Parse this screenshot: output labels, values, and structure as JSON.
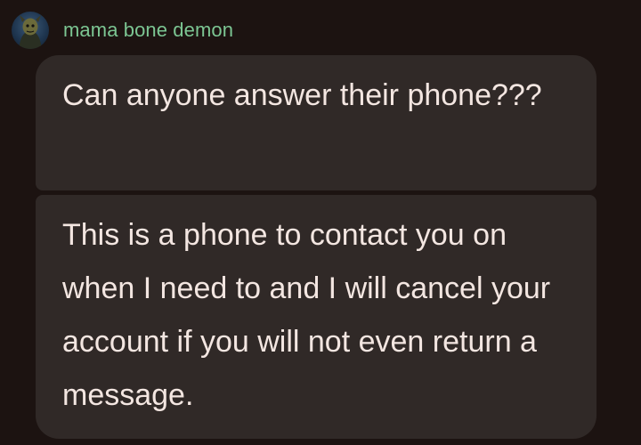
{
  "conversation": {
    "sender": {
      "name": "mama bone demon",
      "avatar_icon": "demon-avatar-icon"
    },
    "messages": [
      {
        "text": "Can anyone answer their phone???"
      },
      {
        "text": "This is a phone to contact you on when I need to and I will cancel your account if you will not even return a message."
      }
    ]
  },
  "colors": {
    "background": "#1c1311",
    "bubble": "#302927",
    "sender_name": "#7cc693",
    "message_text": "#f3e6e1"
  }
}
